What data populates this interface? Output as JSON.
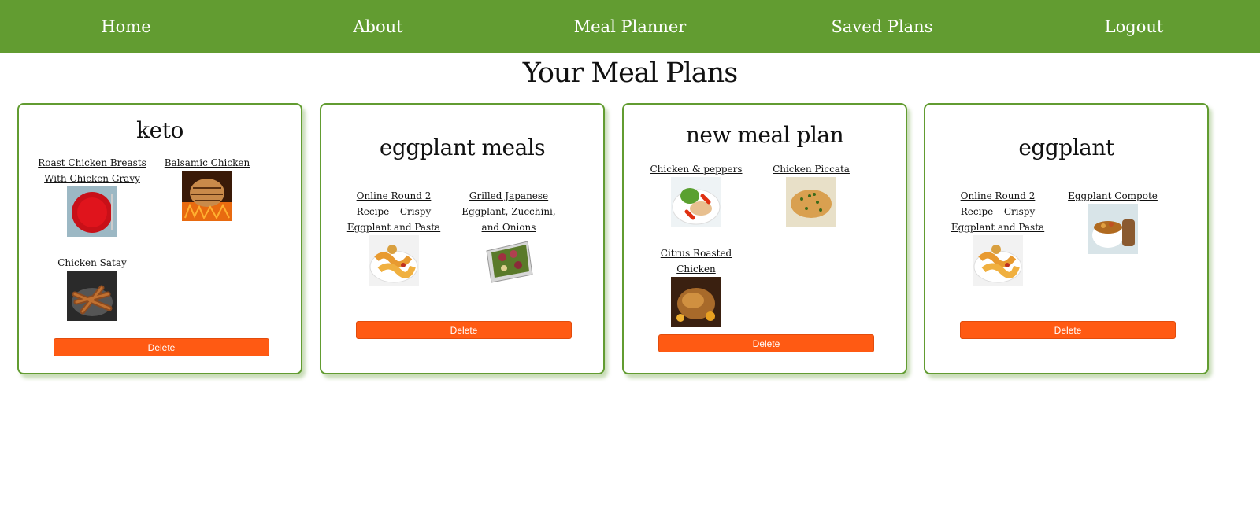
{
  "nav": {
    "home": "Home",
    "about": "About",
    "meal_planner": "Meal Planner",
    "saved_plans": "Saved Plans",
    "logout": "Logout"
  },
  "page_title": "Your Meal Plans",
  "colors": {
    "nav_bg": "#629c31",
    "card_border": "#629c31",
    "delete_button": "#ff5a13"
  },
  "plans": [
    {
      "title": "keto",
      "recipes": [
        {
          "name": "Roast Chicken Breasts With Chicken Gravy",
          "image": "red-plate-photo"
        },
        {
          "name": "Balsamic Chicken",
          "image": "grilled-chicken-photo"
        },
        {
          "name": "Chicken Satay",
          "image": "chicken-satay-photo"
        }
      ],
      "delete_label": "Delete"
    },
    {
      "title": "eggplant meals",
      "recipes": [
        {
          "name": "Online Round 2 Recipe – Crispy Eggplant and Pasta",
          "image": "pasta-photo"
        },
        {
          "name": "Grilled Japanese Eggplant, Zucchini, and Onions",
          "image": "grilled-vegetables-photo"
        }
      ],
      "delete_label": "Delete"
    },
    {
      "title": "new meal plan",
      "recipes": [
        {
          "name": "Chicken & peppers",
          "image": "chicken-peppers-photo"
        },
        {
          "name": "Chicken Piccata",
          "image": "chicken-piccata-photo"
        },
        {
          "name": "Citrus Roasted Chicken",
          "image": "roasted-chicken-photo"
        }
      ],
      "delete_label": "Delete"
    },
    {
      "title": "eggplant",
      "recipes": [
        {
          "name": "Online Round 2 Recipe – Crispy Eggplant and Pasta",
          "image": "pasta-photo"
        },
        {
          "name": "Eggplant Compote",
          "image": "eggplant-compote-photo"
        }
      ],
      "delete_label": "Delete"
    }
  ]
}
